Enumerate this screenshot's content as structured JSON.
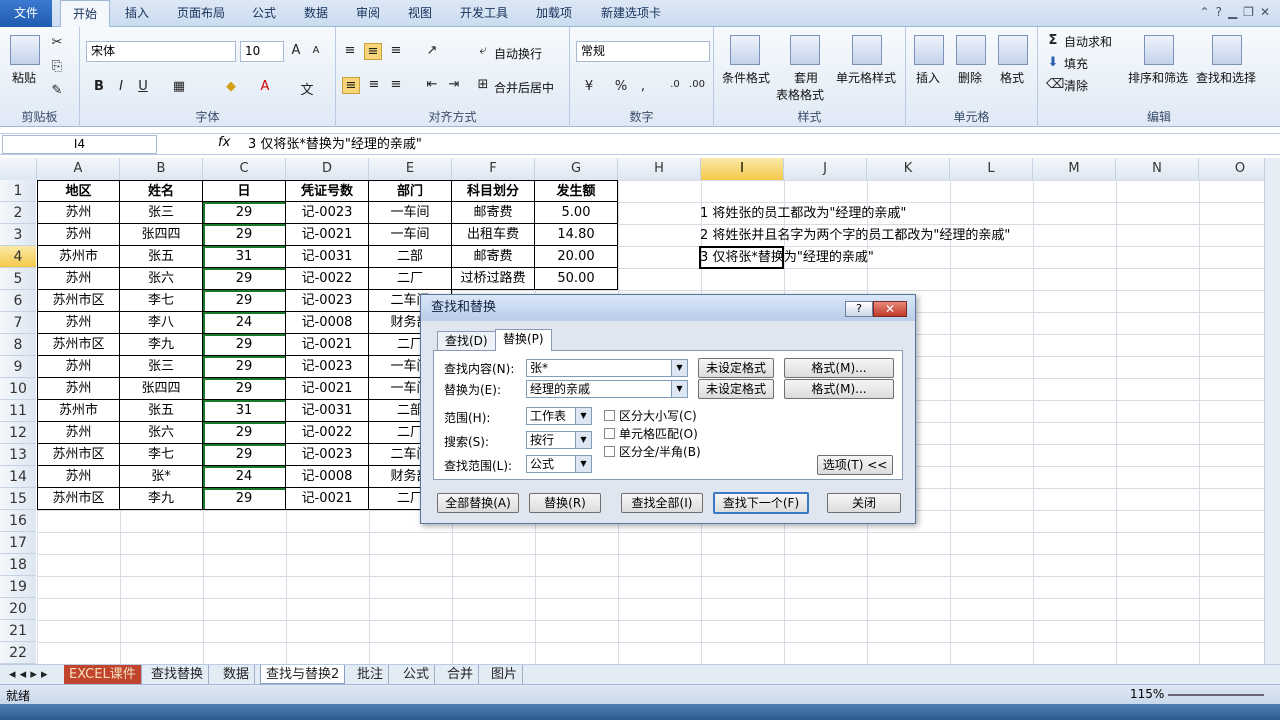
{
  "tabs": {
    "file": "文件",
    "items": [
      "开始",
      "插入",
      "页面布局",
      "公式",
      "数据",
      "审阅",
      "视图",
      "开发工具",
      "加载项",
      "新建选项卡"
    ]
  },
  "ribbon": {
    "paste": "粘贴",
    "clipboard": "剪贴板",
    "font_name": "宋体",
    "font_size": "10",
    "font_group": "字体",
    "wrap": "自动换行",
    "merge": "合并后居中",
    "align_group": "对齐方式",
    "number_format": "常规",
    "number_group": "数字",
    "cond_format": "条件格式",
    "table_fmt1": "套用",
    "table_fmt2": "表格格式",
    "cell_style": "单元格样式",
    "style_group": "样式",
    "insert": "插入",
    "delete": "删除",
    "format": "格式",
    "cells_group": "单元格",
    "autosum": "自动求和",
    "fill": "填充",
    "clear": "清除",
    "sort_filter": "排序和筛选",
    "find_select": "查找和选择",
    "edit_group": "编辑"
  },
  "formula_bar": {
    "name_box": "I4",
    "fx": "fx",
    "content": "3 仅将张*替换为\"经理的亲戚\""
  },
  "columns": [
    "A",
    "B",
    "C",
    "D",
    "E",
    "F",
    "G",
    "H",
    "I",
    "J",
    "K",
    "L",
    "M",
    "N",
    "O"
  ],
  "rows": [
    "1",
    "2",
    "3",
    "4",
    "5",
    "6",
    "7",
    "8",
    "9",
    "10",
    "11",
    "12",
    "13",
    "14",
    "15",
    "16",
    "17",
    "18",
    "19",
    "20",
    "21",
    "22"
  ],
  "table": {
    "headers": [
      "地区",
      "姓名",
      "日",
      "凭证号数",
      "部门",
      "科目划分",
      "发生额"
    ],
    "rows": [
      [
        "苏州",
        "张三",
        "29",
        "记-0023",
        "一车间",
        "邮寄费",
        "5.00"
      ],
      [
        "苏州",
        "张四四",
        "29",
        "记-0021",
        "一车间",
        "出租车费",
        "14.80"
      ],
      [
        "苏州市",
        "张五",
        "31",
        "记-0031",
        "二部",
        "邮寄费",
        "20.00"
      ],
      [
        "苏州",
        "张六",
        "29",
        "记-0022",
        "二厂",
        "过桥过路费",
        "50.00"
      ],
      [
        "苏州市区",
        "李七",
        "29",
        "记-0023",
        "二车间",
        "",
        ""
      ],
      [
        "苏州",
        "李八",
        "24",
        "记-0008",
        "财务部",
        "",
        ""
      ],
      [
        "苏州市区",
        "李九",
        "29",
        "记-0021",
        "二厂",
        "",
        ""
      ],
      [
        "苏州",
        "张三",
        "29",
        "记-0023",
        "一车间",
        "",
        ""
      ],
      [
        "苏州",
        "张四四",
        "29",
        "记-0021",
        "一车间",
        "",
        ""
      ],
      [
        "苏州市",
        "张五",
        "31",
        "记-0031",
        "二部",
        "",
        ""
      ],
      [
        "苏州",
        "张六",
        "29",
        "记-0022",
        "二厂",
        "",
        ""
      ],
      [
        "苏州市区",
        "李七",
        "29",
        "记-0023",
        "二车间",
        "",
        ""
      ],
      [
        "苏州",
        "张*",
        "24",
        "记-0008",
        "财务部",
        "",
        ""
      ],
      [
        "苏州市区",
        "李九",
        "29",
        "记-0021",
        "二厂",
        "",
        ""
      ]
    ]
  },
  "notes": [
    "1 将姓张的员工都改为\"经理的亲戚\"",
    "2 将姓张并且名字为两个字的员工都改为\"经理的亲戚\"",
    "3 仅将张*替换为\"经理的亲戚\""
  ],
  "sheets": [
    "EXCEL课件",
    "查找替换",
    "数据",
    "查找与替换2",
    "批注",
    "公式",
    "合并",
    "图片"
  ],
  "status": {
    "ready": "就绪",
    "zoom": "115%"
  },
  "dialog": {
    "title": "查找和替换",
    "help": "?",
    "close": "✕",
    "tab_find": "查找(D)",
    "tab_replace": "替换(P)",
    "find_label": "查找内容(N):",
    "find_value": "张*",
    "replace_label": "替换为(E):",
    "replace_value": "经理的亲戚",
    "no_format": "未设定格式",
    "format_btn": "格式(M)...",
    "scope_label": "范围(H):",
    "scope_value": "工作表",
    "search_label": "搜索(S):",
    "search_value": "按行",
    "lookin_label": "查找范围(L):",
    "lookin_value": "公式",
    "match_case": "区分大小写(C)",
    "match_cell": "单元格匹配(O)",
    "match_width": "区分全/半角(B)",
    "options_btn": "选项(T) <<",
    "replace_all": "全部替换(A)",
    "replace": "替换(R)",
    "find_all": "查找全部(I)",
    "find_next": "查找下一个(F)",
    "close_btn": "关闭"
  }
}
